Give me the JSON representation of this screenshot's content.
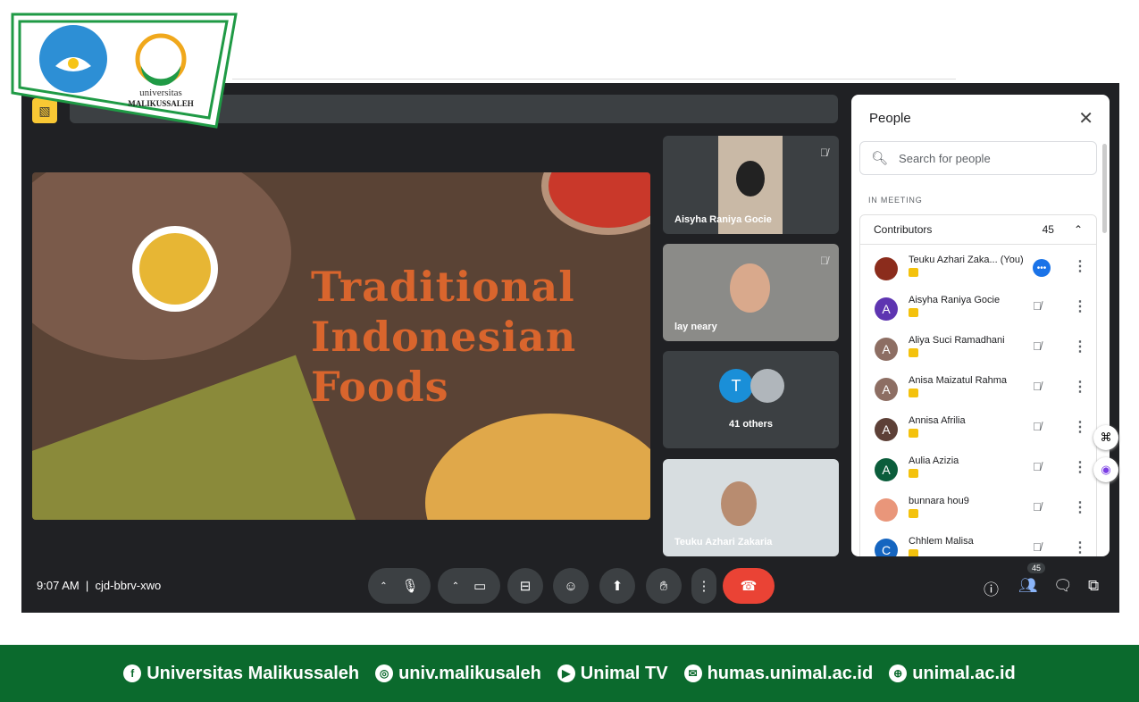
{
  "logo": {
    "left_text": "TUT WURI HANDAYANI",
    "univ_line1": "universitas",
    "univ_line2": "MALIKUSSALEH"
  },
  "slide": {
    "title_lines": [
      "Traditional",
      "Indonesian",
      "Foods"
    ]
  },
  "tiles": [
    {
      "name": "Aisyha Raniya Gocie",
      "muted": true
    },
    {
      "name": "lay neary",
      "muted": true
    },
    {
      "name": "41 others",
      "avatar": "T"
    },
    {
      "name": "Teuku Azhari Zakaria"
    }
  ],
  "people": {
    "title": "People",
    "search_placeholder": "Search for people",
    "section": "IN MEETING",
    "group": "Contributors",
    "count": "45",
    "members": [
      {
        "name": "Teuku Azhari Zaka...  (You)",
        "initial": "",
        "color": "#8b2c1c"
      },
      {
        "name": "Aisyha Raniya Gocie",
        "initial": "A",
        "color": "#5e35b1"
      },
      {
        "name": "Aliya Suci Ramadhani",
        "initial": "A",
        "color": "#8d6e63"
      },
      {
        "name": "Anisa Maizatul Rahma",
        "initial": "A",
        "color": "#8d6e63"
      },
      {
        "name": "Annisa Afrilia",
        "initial": "A",
        "color": "#5d4037"
      },
      {
        "name": "Aulia Azizia",
        "initial": "A",
        "color": "#0b5d3b"
      },
      {
        "name": "bunnara hou9",
        "initial": "",
        "color": "#e9967a"
      },
      {
        "name": "Chhlem Malisa",
        "initial": "C",
        "color": "#1565c0"
      }
    ]
  },
  "bottom": {
    "time": "9:07 AM",
    "meeting_code": "cjd-bbrv-xwo",
    "participants_badge": "45",
    "end_color": "#ea4335"
  },
  "footer": [
    {
      "icon": "facebook",
      "text": "Universitas Malikussaleh"
    },
    {
      "icon": "instagram",
      "text": "univ.malikusaleh"
    },
    {
      "icon": "youtube",
      "text": "Unimal TV"
    },
    {
      "icon": "email",
      "text": "humas.unimal.ac.id"
    },
    {
      "icon": "globe",
      "text": "unimal.ac.id"
    }
  ]
}
